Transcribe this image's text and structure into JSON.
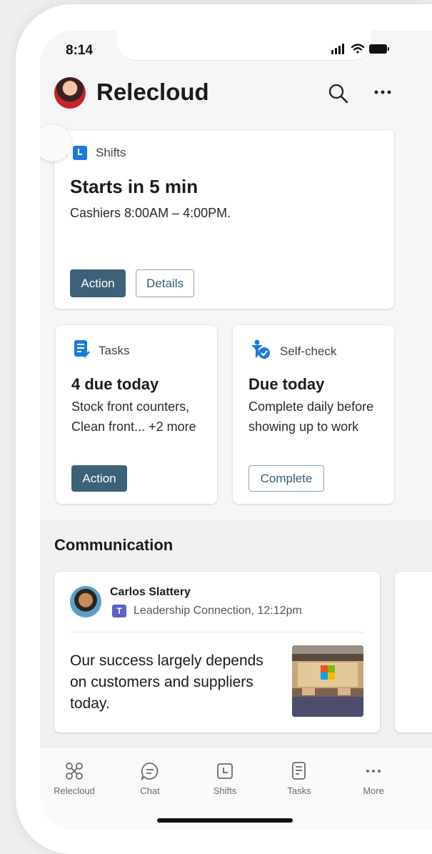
{
  "status_bar": {
    "time": "8:14"
  },
  "header": {
    "title": "Relecloud"
  },
  "shifts_card": {
    "label": "Shifts",
    "title": "Starts in 5 min",
    "subtitle": "Cashiers 8:00AM – 4:00PM.",
    "action_label": "Action",
    "details_label": "Details"
  },
  "tasks_card": {
    "label": "Tasks",
    "title": "4 due today",
    "body": "Stock front counters, Clean front... +2 more",
    "action_label": "Action"
  },
  "selfcheck_card": {
    "label": "Self-check",
    "title": "Due today",
    "body": "Complete daily before showing up to work",
    "complete_label": "Complete"
  },
  "communication": {
    "section_title": "Communication",
    "post": {
      "author": "Carlos Slattery",
      "meta": "Leadership Connection, 12:12pm",
      "text": "Our success largely depends on customers and suppliers today."
    }
  },
  "bottom_nav": [
    {
      "label": "Relecloud",
      "icon": "relecloud-icon"
    },
    {
      "label": "Chat",
      "icon": "chat-icon"
    },
    {
      "label": "Shifts",
      "icon": "shifts-icon"
    },
    {
      "label": "Tasks",
      "icon": "tasks-icon"
    },
    {
      "label": "More",
      "icon": "more-icon"
    }
  ],
  "colors": {
    "primary_button": "#3d6179",
    "shift_icon": "#1a7ad9",
    "teams": "#5b5fc7"
  }
}
